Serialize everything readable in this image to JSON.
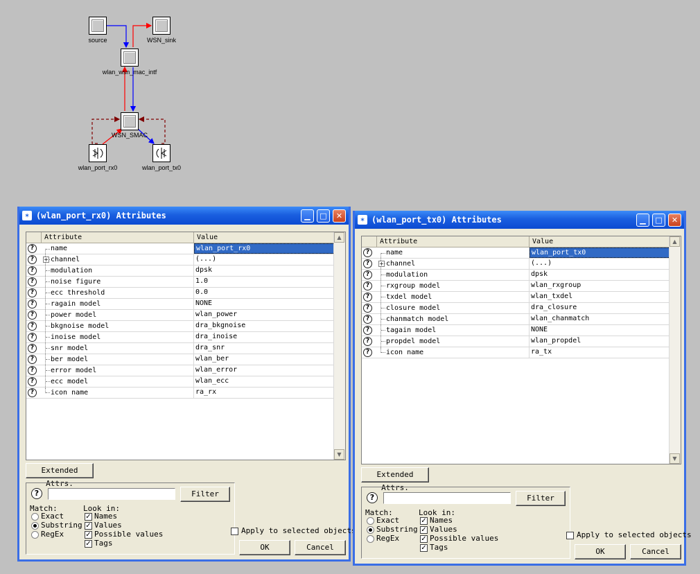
{
  "canvas": {
    "nodes": {
      "source": "source",
      "wsn_sink": "WSN_sink",
      "mac_intf": "wlan_wsn_mac_intf",
      "smac": "WSN_SMAC",
      "port_rx": "wlan_port_rx0",
      "port_tx": "wlan_port_tx0"
    }
  },
  "dialog_rx": {
    "title": "(wlan_port_rx0) Attributes",
    "col_attribute": "Attribute",
    "col_value": "Value",
    "rows": [
      {
        "attr": "name",
        "value": "wlan_port_rx0",
        "selected": true
      },
      {
        "attr": "channel",
        "value": "(...)",
        "expandable": true
      },
      {
        "attr": "modulation",
        "value": "dpsk"
      },
      {
        "attr": "noise figure",
        "value": "1.0"
      },
      {
        "attr": "ecc threshold",
        "value": "0.0"
      },
      {
        "attr": "ragain model",
        "value": "NONE"
      },
      {
        "attr": "power model",
        "value": "wlan_power"
      },
      {
        "attr": "bkgnoise model",
        "value": "dra_bkgnoise"
      },
      {
        "attr": "inoise model",
        "value": "dra_inoise"
      },
      {
        "attr": "snr model",
        "value": "dra_snr"
      },
      {
        "attr": "ber model",
        "value": "wlan_ber"
      },
      {
        "attr": "error model",
        "value": "wlan_error"
      },
      {
        "attr": "ecc model",
        "value": "wlan_ecc"
      },
      {
        "attr": "icon name",
        "value": "ra_rx"
      }
    ],
    "extended_attrs": "Extended Attrs.",
    "filter_button": "Filter",
    "filter_value": "",
    "match_label": "Match:",
    "match_exact": "Exact",
    "match_substring": "Substring",
    "match_regex": "RegEx",
    "look_in_label": "Look in:",
    "look_names": "Names",
    "look_values": "Values",
    "look_possible": "Possible values",
    "look_tags": "Tags",
    "apply_selected": "Apply to selected objects",
    "ok": "OK",
    "cancel": "Cancel"
  },
  "dialog_tx": {
    "title": "(wlan_port_tx0) Attributes",
    "col_attribute": "Attribute",
    "col_value": "Value",
    "rows": [
      {
        "attr": "name",
        "value": "wlan_port_tx0",
        "selected": true
      },
      {
        "attr": "channel",
        "value": "(...)",
        "expandable": true
      },
      {
        "attr": "modulation",
        "value": "dpsk"
      },
      {
        "attr": "rxgroup model",
        "value": "wlan_rxgroup"
      },
      {
        "attr": "txdel model",
        "value": "wlan_txdel"
      },
      {
        "attr": "closure model",
        "value": "dra_closure"
      },
      {
        "attr": "chanmatch model",
        "value": "wlan_chanmatch"
      },
      {
        "attr": "tagain model",
        "value": "NONE"
      },
      {
        "attr": "propdel model",
        "value": "wlan_propdel"
      },
      {
        "attr": "icon name",
        "value": "ra_tx"
      }
    ],
    "extended_attrs": "Extended Attrs.",
    "filter_button": "Filter",
    "filter_value": "",
    "match_label": "Match:",
    "match_exact": "Exact",
    "match_substring": "Substring",
    "match_regex": "RegEx",
    "look_in_label": "Look in:",
    "look_names": "Names",
    "look_values": "Values",
    "look_possible": "Possible values",
    "look_tags": "Tags",
    "apply_selected": "Apply to selected objects",
    "ok": "OK",
    "cancel": "Cancel"
  },
  "colors": {
    "title_blue": "#0b4ad1",
    "selection": "#316ac5",
    "arrow_red": "#ff0000",
    "arrow_blue": "#0000ff",
    "dashed_link": "#800000"
  }
}
